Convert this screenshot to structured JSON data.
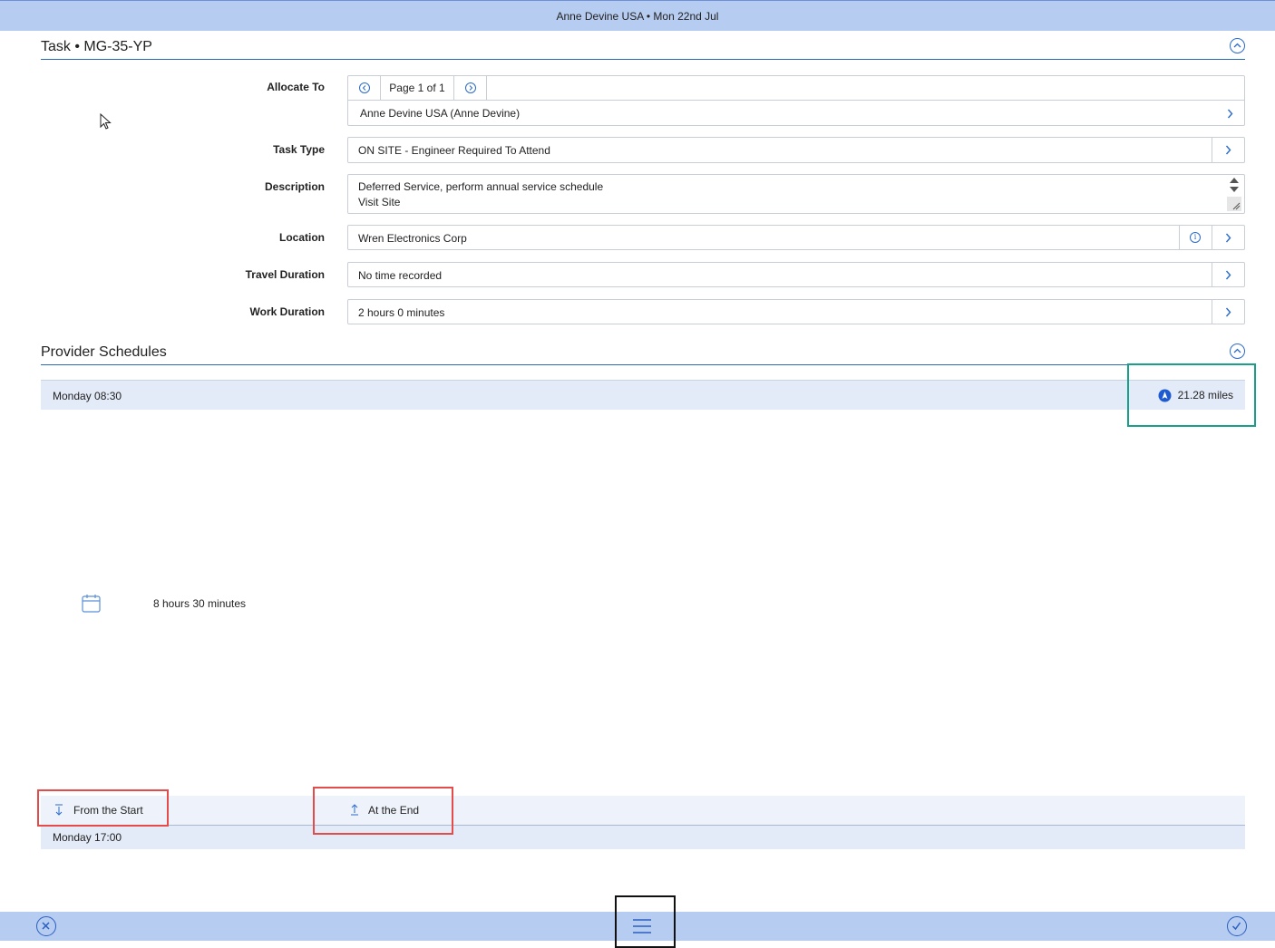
{
  "header": {
    "title": "Anne Devine USA • Mon 22nd Jul"
  },
  "task": {
    "section_title": "Task • MG-35-YP",
    "fields": {
      "allocate_to": {
        "label": "Allocate To",
        "pager_text": "Page 1 of 1",
        "value": "Anne Devine USA (Anne Devine)"
      },
      "task_type": {
        "label": "Task Type",
        "value": "ON SITE  - Engineer Required To Attend"
      },
      "description": {
        "label": "Description",
        "line1": "Deferred Service, perform annual service schedule",
        "line2": "Visit Site"
      },
      "location": {
        "label": "Location",
        "value": "Wren Electronics Corp"
      },
      "travel_duration": {
        "label": "Travel Duration",
        "value": "No time recorded"
      },
      "work_duration": {
        "label": "Work Duration",
        "value": "2 hours 0 minutes"
      }
    }
  },
  "provider": {
    "section_title": "Provider Schedules",
    "start_row": {
      "time": "Monday 08:30",
      "distance": "21.28 miles"
    },
    "duration": "8 hours 30 minutes",
    "from_start_label": "From the Start",
    "at_end_label": "At the End",
    "end_row": {
      "time": "Monday 17:00"
    }
  },
  "colors": {
    "accent": "#2b6bc9",
    "bar": "#b6ccf0",
    "row": "#e3ebf8",
    "highlight_green": "#1aa08a",
    "highlight_red": "#e44b4b",
    "highlight_black": "#111111"
  },
  "icons": [
    "chevron-up-icon",
    "chevron-right-icon",
    "chevron-left-icon",
    "info-icon",
    "navigation-icon",
    "calendar-icon",
    "arrow-down-icon",
    "arrow-up-icon",
    "close-icon",
    "menu-icon",
    "check-icon"
  ]
}
